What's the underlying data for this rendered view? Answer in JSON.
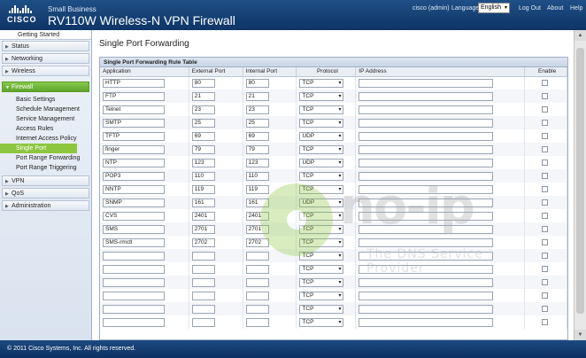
{
  "header": {
    "brand_small": "Small Business",
    "brand_title": "RV110W Wireless-N VPN Firewall",
    "logo_text": "CISCO",
    "user": "cisco (admin)",
    "language_label": "Language:",
    "language_value": "English",
    "logout": "Log Out",
    "about": "About",
    "help": "Help"
  },
  "sidebar": {
    "getting_started": "Getting Started",
    "sections": [
      {
        "label": "Status"
      },
      {
        "label": "Networking"
      },
      {
        "label": "Wireless"
      },
      {
        "label": "Firewall"
      }
    ],
    "firewall_items": [
      "Basic Settings",
      "Schedule Management",
      "Service Management",
      "Access Rules",
      "Internet Access Policy",
      "Single Port Forwarding",
      "Port Range Forwarding",
      "Port Range Triggering"
    ],
    "after_sections": [
      {
        "label": "VPN"
      },
      {
        "label": "QoS"
      },
      {
        "label": "Administration"
      }
    ]
  },
  "main": {
    "title": "Single Port Forwarding",
    "table_caption": "Single Port Forwarding Rule Table",
    "columns": [
      "Application",
      "External Port",
      "Internal Port",
      "Protocol",
      "IP Address",
      "Enable"
    ],
    "rows": [
      {
        "app": "HTTP",
        "ext": "80",
        "int": "80",
        "proto": "TCP",
        "ip": ""
      },
      {
        "app": "FTP",
        "ext": "21",
        "int": "21",
        "proto": "TCP",
        "ip": ""
      },
      {
        "app": "Telnet",
        "ext": "23",
        "int": "23",
        "proto": "TCP",
        "ip": ""
      },
      {
        "app": "SMTP",
        "ext": "25",
        "int": "25",
        "proto": "TCP",
        "ip": ""
      },
      {
        "app": "TFTP",
        "ext": "69",
        "int": "69",
        "proto": "UDP",
        "ip": ""
      },
      {
        "app": "finger",
        "ext": "79",
        "int": "79",
        "proto": "TCP",
        "ip": ""
      },
      {
        "app": "NTP",
        "ext": "123",
        "int": "123",
        "proto": "UDP",
        "ip": ""
      },
      {
        "app": "POP3",
        "ext": "110",
        "int": "110",
        "proto": "TCP",
        "ip": ""
      },
      {
        "app": "NNTP",
        "ext": "119",
        "int": "119",
        "proto": "TCP",
        "ip": ""
      },
      {
        "app": "SNMP",
        "ext": "161",
        "int": "161",
        "proto": "UDP",
        "ip": ""
      },
      {
        "app": "CVS",
        "ext": "2401",
        "int": "2401",
        "proto": "TCP",
        "ip": ""
      },
      {
        "app": "SMS",
        "ext": "2701",
        "int": "2701",
        "proto": "TCP",
        "ip": ""
      },
      {
        "app": "SMS-rmctl",
        "ext": "2702",
        "int": "2702",
        "proto": "TCP",
        "ip": ""
      },
      {
        "app": "",
        "ext": "",
        "int": "",
        "proto": "TCP",
        "ip": ""
      },
      {
        "app": "",
        "ext": "",
        "int": "",
        "proto": "TCP",
        "ip": ""
      },
      {
        "app": "",
        "ext": "",
        "int": "",
        "proto": "TCP",
        "ip": ""
      },
      {
        "app": "",
        "ext": "",
        "int": "",
        "proto": "TCP",
        "ip": ""
      },
      {
        "app": "",
        "ext": "",
        "int": "",
        "proto": "TCP",
        "ip": ""
      },
      {
        "app": "",
        "ext": "",
        "int": "",
        "proto": "TCP",
        "ip": ""
      }
    ]
  },
  "watermark": {
    "text": "no-ip",
    "tagline": "The DNS Service Provider"
  },
  "footer": {
    "copyright": "© 2011 Cisco Systems, Inc. All rights reserved."
  },
  "colors": {
    "header": "#123d72",
    "accent_green": "#8cc63f",
    "sidebar": "#e3e9f2"
  },
  "icons": {
    "expand": "triangle-right-icon",
    "collapse": "triangle-down-icon",
    "dropdown": "chevron-down-icon"
  }
}
